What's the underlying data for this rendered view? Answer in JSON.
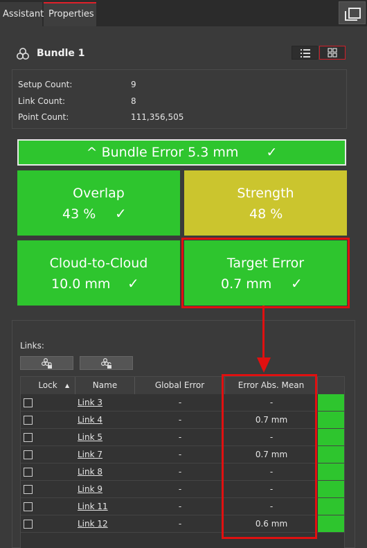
{
  "tabs": [
    {
      "label": "Assistant"
    },
    {
      "label": "Properties"
    }
  ],
  "bundle": {
    "title": "Bundle 1",
    "icon": "bundle-icon",
    "view_icons": [
      "list-view-icon",
      "grid-view-icon"
    ]
  },
  "info": [
    {
      "label": "Setup Count:",
      "value": "9"
    },
    {
      "label": "Link Count:",
      "value": "8"
    },
    {
      "label": "Point Count:",
      "value": "111,356,505"
    }
  ],
  "quality": {
    "bundle_error": "^ Bundle Error 5.3 mm",
    "check": "✓",
    "tiles": {
      "overlap": {
        "title": "Overlap",
        "value": "43 %"
      },
      "strength": {
        "title": "Strength",
        "value": "48 %"
      },
      "c2c": {
        "title": "Cloud-to-Cloud",
        "value": "10.0 mm"
      },
      "target": {
        "title": "Target Error",
        "value": "0.7 mm"
      }
    },
    "colors": {
      "good": "#2ec52e",
      "warn": "#cbc52e",
      "highlight": "#e01010"
    }
  },
  "links": {
    "label": "Links:",
    "headers": {
      "lock": "Lock",
      "name": "Name",
      "global": "Global Error",
      "abs": "Error Abs. Mean"
    },
    "rows": [
      {
        "name": "Link 3",
        "global": "-",
        "abs": "-"
      },
      {
        "name": "Link 4",
        "global": "-",
        "abs": "0.7 mm"
      },
      {
        "name": "Link 5",
        "global": "-",
        "abs": "-"
      },
      {
        "name": "Link 7",
        "global": "-",
        "abs": "0.7 mm"
      },
      {
        "name": "Link 8",
        "global": "-",
        "abs": "-"
      },
      {
        "name": "Link 9",
        "global": "-",
        "abs": "-"
      },
      {
        "name": "Link 11",
        "global": "-",
        "abs": "-"
      },
      {
        "name": "Link 12",
        "global": "-",
        "abs": "0.6 mm"
      }
    ]
  }
}
